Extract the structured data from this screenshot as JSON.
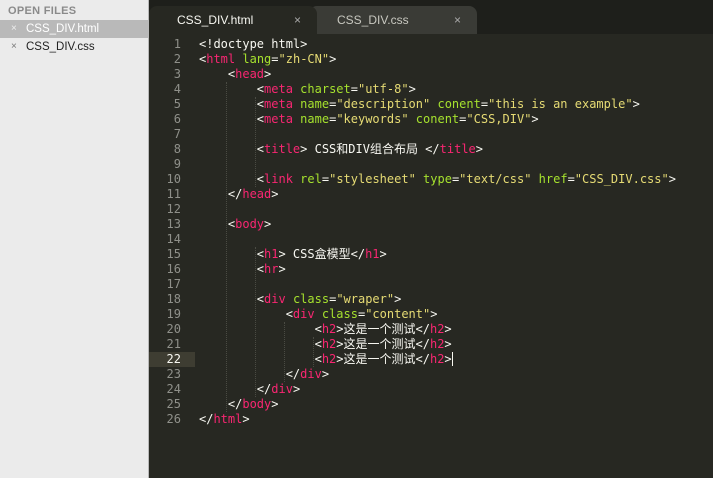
{
  "sidebar": {
    "header": "OPEN FILES",
    "close_glyph": "×",
    "files": [
      {
        "name": "CSS_DIV.html",
        "active": true
      },
      {
        "name": "CSS_DIV.css",
        "active": false
      }
    ]
  },
  "tabs": [
    {
      "label": "CSS_DIV.html",
      "active": true,
      "close_glyph": "×"
    },
    {
      "label": "CSS_DIV.css",
      "active": false,
      "close_glyph": "×"
    }
  ],
  "editor": {
    "current_line": 22,
    "line_count": 26,
    "lines": [
      [
        {
          "k": "p",
          "x": "<!doctype html>"
        }
      ],
      [
        {
          "k": "p",
          "x": "<"
        },
        {
          "k": "t",
          "x": "html"
        },
        {
          "k": "p",
          "x": " "
        },
        {
          "k": "a",
          "x": "lang"
        },
        {
          "k": "p",
          "x": "="
        },
        {
          "k": "s",
          "x": "\"zh-CN\""
        },
        {
          "k": "p",
          "x": ">"
        }
      ],
      [
        {
          "k": "p",
          "x": "    <"
        },
        {
          "k": "t",
          "x": "head"
        },
        {
          "k": "p",
          "x": ">"
        }
      ],
      [
        {
          "k": "p",
          "x": "        <"
        },
        {
          "k": "t",
          "x": "meta"
        },
        {
          "k": "p",
          "x": " "
        },
        {
          "k": "a",
          "x": "charset"
        },
        {
          "k": "p",
          "x": "="
        },
        {
          "k": "s",
          "x": "\"utf-8\""
        },
        {
          "k": "p",
          "x": ">"
        }
      ],
      [
        {
          "k": "p",
          "x": "        <"
        },
        {
          "k": "t",
          "x": "meta"
        },
        {
          "k": "p",
          "x": " "
        },
        {
          "k": "a",
          "x": "name"
        },
        {
          "k": "p",
          "x": "="
        },
        {
          "k": "s",
          "x": "\"description\""
        },
        {
          "k": "p",
          "x": " "
        },
        {
          "k": "a",
          "x": "conent"
        },
        {
          "k": "p",
          "x": "="
        },
        {
          "k": "s",
          "x": "\"this is an example\""
        },
        {
          "k": "p",
          "x": ">"
        }
      ],
      [
        {
          "k": "p",
          "x": "        <"
        },
        {
          "k": "t",
          "x": "meta"
        },
        {
          "k": "p",
          "x": " "
        },
        {
          "k": "a",
          "x": "name"
        },
        {
          "k": "p",
          "x": "="
        },
        {
          "k": "s",
          "x": "\"keywords\""
        },
        {
          "k": "p",
          "x": " "
        },
        {
          "k": "a",
          "x": "conent"
        },
        {
          "k": "p",
          "x": "="
        },
        {
          "k": "s",
          "x": "\"CSS,DIV\""
        },
        {
          "k": "p",
          "x": ">"
        }
      ],
      [],
      [
        {
          "k": "p",
          "x": "        <"
        },
        {
          "k": "t",
          "x": "title"
        },
        {
          "k": "p",
          "x": "> CSS和DIV组合布局 </"
        },
        {
          "k": "t",
          "x": "title"
        },
        {
          "k": "p",
          "x": ">"
        }
      ],
      [],
      [
        {
          "k": "p",
          "x": "        <"
        },
        {
          "k": "t",
          "x": "link"
        },
        {
          "k": "p",
          "x": " "
        },
        {
          "k": "a",
          "x": "rel"
        },
        {
          "k": "p",
          "x": "="
        },
        {
          "k": "s",
          "x": "\"stylesheet\""
        },
        {
          "k": "p",
          "x": " "
        },
        {
          "k": "a",
          "x": "type"
        },
        {
          "k": "p",
          "x": "="
        },
        {
          "k": "s",
          "x": "\"text/css\""
        },
        {
          "k": "p",
          "x": " "
        },
        {
          "k": "a",
          "x": "href"
        },
        {
          "k": "p",
          "x": "="
        },
        {
          "k": "s",
          "x": "\"CSS_DIV.css\""
        },
        {
          "k": "p",
          "x": ">"
        }
      ],
      [
        {
          "k": "p",
          "x": "    </"
        },
        {
          "k": "t",
          "x": "head"
        },
        {
          "k": "p",
          "x": ">"
        }
      ],
      [],
      [
        {
          "k": "p",
          "x": "    <"
        },
        {
          "k": "t",
          "x": "body"
        },
        {
          "k": "p",
          "x": ">"
        }
      ],
      [],
      [
        {
          "k": "p",
          "x": "        <"
        },
        {
          "k": "t",
          "x": "h1"
        },
        {
          "k": "p",
          "x": "> CSS盒模型</"
        },
        {
          "k": "t",
          "x": "h1"
        },
        {
          "k": "p",
          "x": ">"
        }
      ],
      [
        {
          "k": "p",
          "x": "        <"
        },
        {
          "k": "t",
          "x": "hr"
        },
        {
          "k": "p",
          "x": ">"
        }
      ],
      [],
      [
        {
          "k": "p",
          "x": "        <"
        },
        {
          "k": "t",
          "x": "div"
        },
        {
          "k": "p",
          "x": " "
        },
        {
          "k": "a",
          "x": "class"
        },
        {
          "k": "p",
          "x": "="
        },
        {
          "k": "s",
          "x": "\"wraper\""
        },
        {
          "k": "p",
          "x": ">"
        }
      ],
      [
        {
          "k": "p",
          "x": "            <"
        },
        {
          "k": "t",
          "x": "div"
        },
        {
          "k": "p",
          "x": " "
        },
        {
          "k": "a",
          "x": "class"
        },
        {
          "k": "p",
          "x": "="
        },
        {
          "k": "s",
          "x": "\"content\""
        },
        {
          "k": "p",
          "x": ">"
        }
      ],
      [
        {
          "k": "p",
          "x": "                <"
        },
        {
          "k": "t",
          "x": "h2"
        },
        {
          "k": "p",
          "x": ">这是一个测试</"
        },
        {
          "k": "t",
          "x": "h2"
        },
        {
          "k": "p",
          "x": ">"
        }
      ],
      [
        {
          "k": "p",
          "x": "                <"
        },
        {
          "k": "t",
          "x": "h2"
        },
        {
          "k": "p",
          "x": ">这是一个测试</"
        },
        {
          "k": "t",
          "x": "h2"
        },
        {
          "k": "p",
          "x": ">"
        }
      ],
      [
        {
          "k": "p",
          "x": "                <"
        },
        {
          "k": "t",
          "x": "h2"
        },
        {
          "k": "p",
          "x": ">这是一个测试</"
        },
        {
          "k": "t",
          "x": "h2"
        },
        {
          "k": "p",
          "x": ">"
        }
      ],
      [
        {
          "k": "p",
          "x": "            </"
        },
        {
          "k": "t",
          "x": "div"
        },
        {
          "k": "p",
          "x": ">"
        }
      ],
      [
        {
          "k": "p",
          "x": "        </"
        },
        {
          "k": "t",
          "x": "div"
        },
        {
          "k": "p",
          "x": ">"
        }
      ],
      [
        {
          "k": "p",
          "x": "    </"
        },
        {
          "k": "t",
          "x": "body"
        },
        {
          "k": "p",
          "x": ">"
        }
      ],
      [
        {
          "k": "p",
          "x": "</"
        },
        {
          "k": "t",
          "x": "html"
        },
        {
          "k": "p",
          "x": ">"
        }
      ]
    ]
  },
  "colors": {
    "background": "#272822",
    "tag": "#f92672",
    "attribute": "#a6e22e",
    "string": "#e6db74",
    "text": "#f8f8f2",
    "line_number": "#8f908a"
  }
}
